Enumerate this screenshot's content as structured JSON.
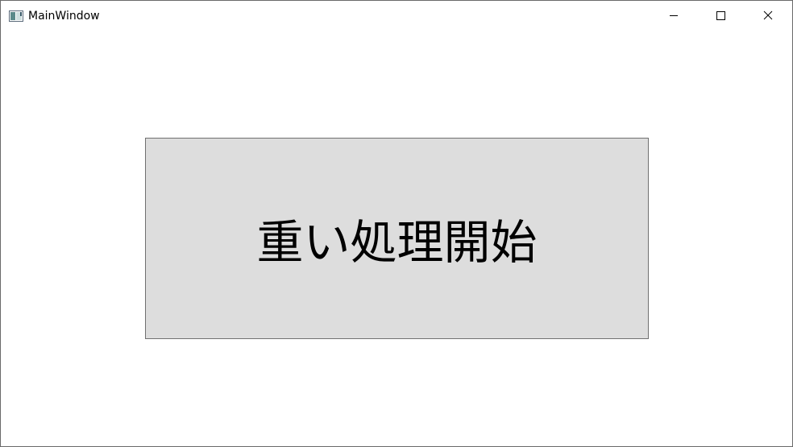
{
  "window": {
    "title": "MainWindow",
    "app_icon": "window-app-icon",
    "controls": {
      "minimize_icon": "minimize-icon",
      "maximize_icon": "maximize-icon",
      "close_icon": "close-icon"
    }
  },
  "main": {
    "start_button_label": "重い処理開始"
  },
  "colors": {
    "button_background": "#dddddd",
    "button_border": "#707070",
    "window_background": "#ffffff",
    "window_border": "#6a6a6a"
  }
}
